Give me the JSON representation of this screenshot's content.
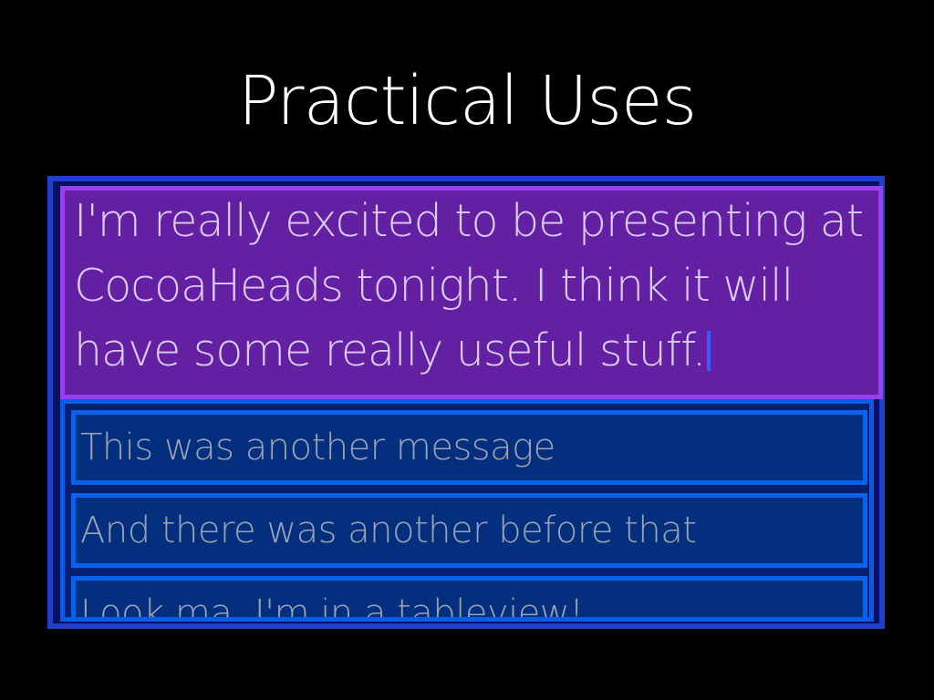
{
  "slide": {
    "title": "Practical Uses"
  },
  "text_view": {
    "value": "I'm really excited to be presenting at CocoaHeads tonight. I think it will have some really useful stuff."
  },
  "table": {
    "rows": [
      "This was another message",
      "And there was another before that",
      "Look ma, I'm in a tableview!"
    ]
  },
  "colors": {
    "background": "#000000",
    "outer_border": "#1f3fcc",
    "text_view_fill": "#6320a3",
    "text_view_border": "#9a3ff0",
    "cell_border": "#0b62ea",
    "cell_fill": "#032f7e"
  }
}
